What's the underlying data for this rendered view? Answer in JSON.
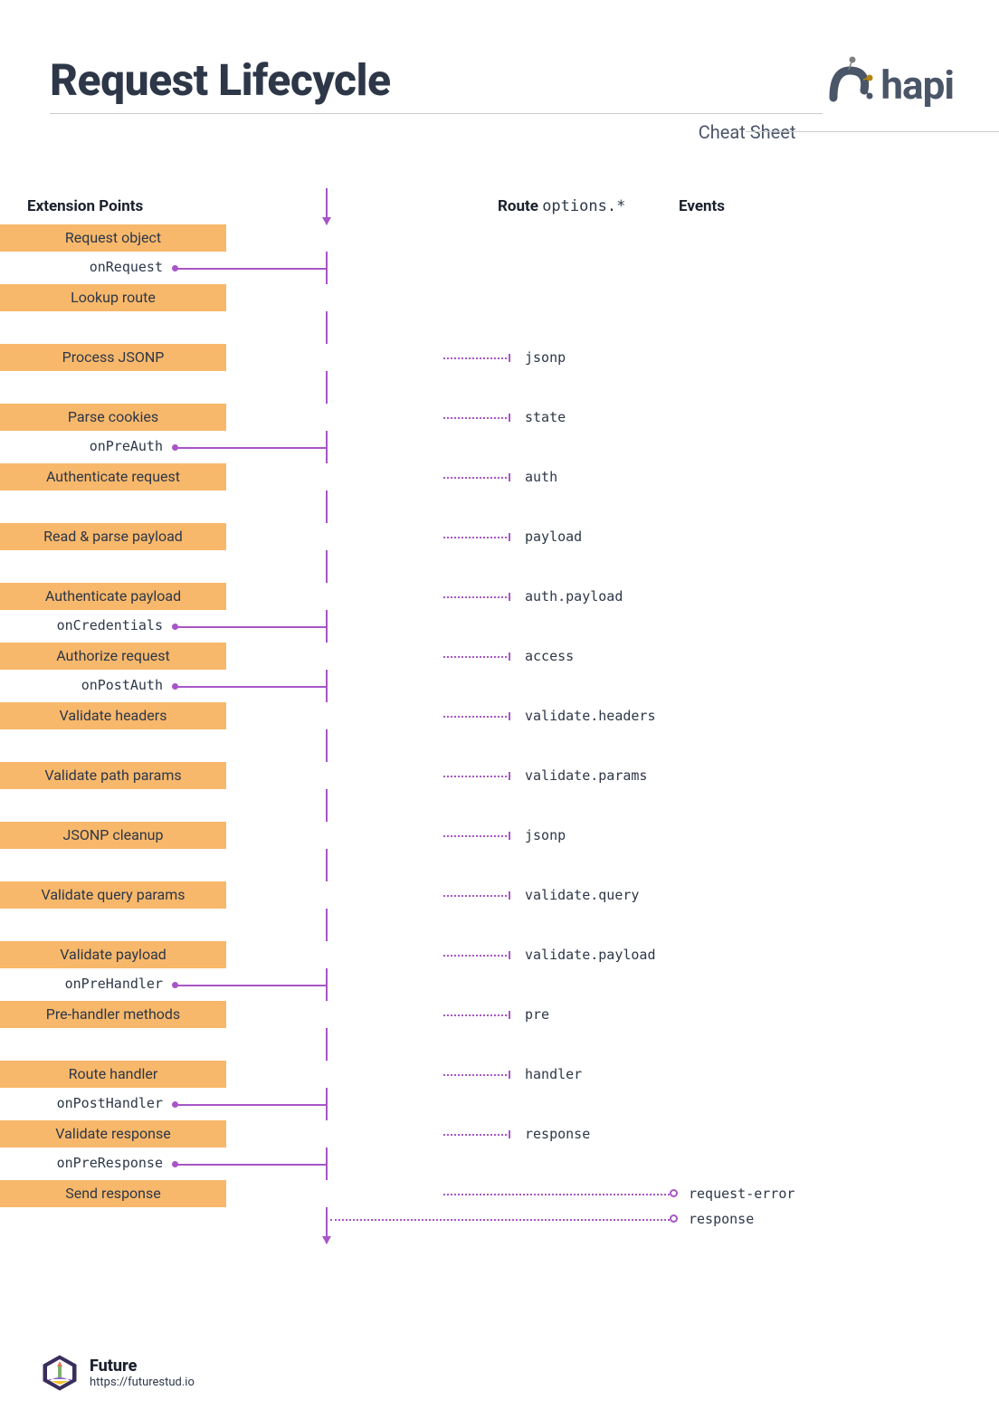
{
  "header": {
    "title": "Request Lifecycle",
    "subtitle": "Cheat Sheet",
    "logo_text": "hapi"
  },
  "column_headers": {
    "extension_points": "Extension Points",
    "route": "Route",
    "route_code": "options.*",
    "events": "Events"
  },
  "steps": [
    {
      "label": "Request object"
    },
    {
      "label": "Lookup route"
    },
    {
      "label": "Process JSONP",
      "option": "jsonp"
    },
    {
      "label": "Parse cookies",
      "option": "state"
    },
    {
      "label": "Authenticate request",
      "option": "auth"
    },
    {
      "label": "Read & parse payload",
      "option": "payload"
    },
    {
      "label": "Authenticate payload",
      "option": "auth.payload"
    },
    {
      "label": "Authorize request",
      "option": "access"
    },
    {
      "label": "Validate headers",
      "option": "validate.headers"
    },
    {
      "label": "Validate path params",
      "option": "validate.params"
    },
    {
      "label": "JSONP cleanup",
      "option": "jsonp"
    },
    {
      "label": "Validate query params",
      "option": "validate.query"
    },
    {
      "label": "Validate payload",
      "option": "validate.payload"
    },
    {
      "label": "Pre-handler methods",
      "option": "pre"
    },
    {
      "label": "Route handler",
      "option": "handler"
    },
    {
      "label": "Validate response",
      "option": "response"
    },
    {
      "label": "Send response"
    }
  ],
  "extensions": [
    {
      "name": "onRequest",
      "after_step": 0
    },
    {
      "name": "onPreAuth",
      "after_step": 3
    },
    {
      "name": "onCredentials",
      "after_step": 6
    },
    {
      "name": "onPostAuth",
      "after_step": 7
    },
    {
      "name": "onPreHandler",
      "after_step": 12
    },
    {
      "name": "onPostHandler",
      "after_step": 14
    },
    {
      "name": "onPreResponse",
      "after_step": 15
    }
  ],
  "events": [
    {
      "name": "request-error",
      "from_step": 16,
      "offset": 0
    },
    {
      "name": "response",
      "from_step": 16,
      "offset": 28
    }
  ],
  "footer": {
    "brand": "Future",
    "url": "https://futurestud.io"
  },
  "colors": {
    "step_bg": "#f8b86b",
    "line": "#a855c7",
    "text": "#2d3748"
  }
}
